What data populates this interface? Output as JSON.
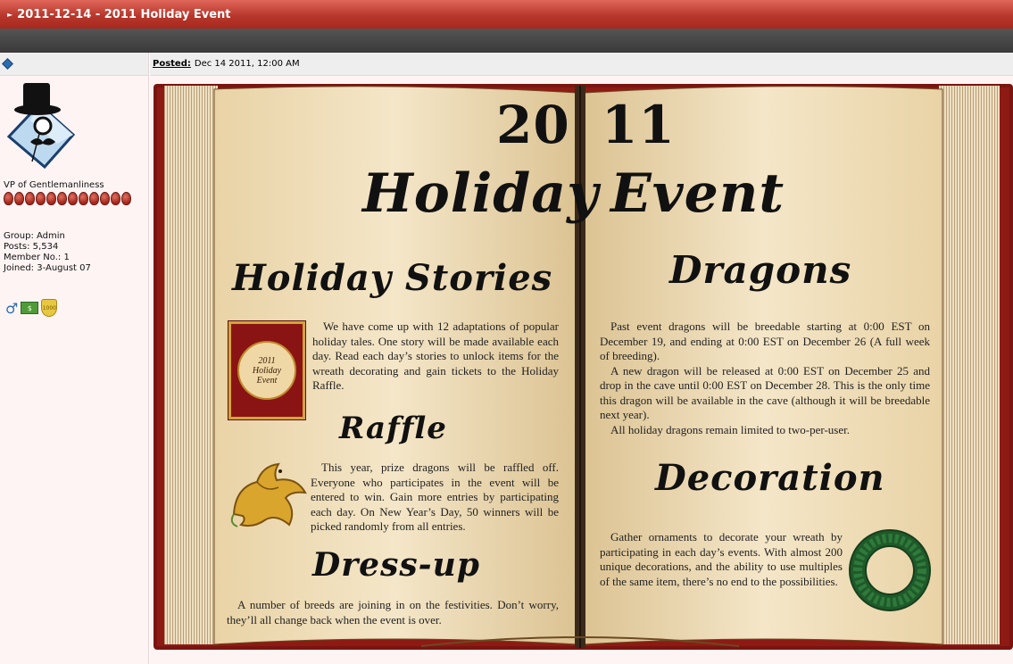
{
  "window": {
    "title": "2011-12-14 - 2011 Holiday Event"
  },
  "user": {
    "title": "VP of Gentlemanliness",
    "group": "Group: Admin",
    "posts": "Posts: 5,534",
    "member_no": "Member No.: 1",
    "joined": "Joined: 3-August 07",
    "pip_count": 12,
    "pip_color": "#b3291f"
  },
  "post": {
    "posted_label": "Posted:",
    "posted_date": "Dec 14 2011, 12:00 AM"
  },
  "book": {
    "year_left": "20",
    "year_right": "11",
    "title_left": "Holiday",
    "title_right": "Event",
    "holiday_stories": {
      "heading": "Holiday Stories",
      "text": "We have come up with 12 adaptations of popular holiday tales. One story will be made available each day. Read each day’s stories to unlock items for the wreath decorating and gain tickets to the Holiday Raffle.",
      "thumb_line1": "2011",
      "thumb_line2": "Holiday",
      "thumb_line3": "Event"
    },
    "raffle": {
      "heading": "Raffle",
      "text": "This year, prize dragons will be raffled off. Everyone who participates in the event will be entered to win. Gain more entries by participating each day. On New Year’s Day, 50 winners will be picked randomly from all entries."
    },
    "dress_up": {
      "heading": "Dress-up",
      "text": "A number of breeds are joining in on the festivities. Don’t worry, they’ll all change back when the event is over."
    },
    "dragons": {
      "heading": "Dragons",
      "p1": "Past event dragons will be breedable starting at 0:00 EST on December 19, and ending at 0:00 EST on December 26 (A full week of breeding).",
      "p2": "A new dragon will be released at 0:00 EST on December 25 and drop in the cave until 0:00 EST on December 28. This is the only time this dragon will be available in the cave (although it will be breedable next year).",
      "p3": "All holiday dragons remain limited to two-per-user."
    },
    "decoration": {
      "heading": "Decoration",
      "text": "Gather ornaments to decorate your wreath by participating in each day’s events. With almost 200 unique decorations, and the ability to use multiples of the same item, there’s no end to the possibilities."
    }
  },
  "colors": {
    "title_bar": "#b8372c",
    "book_cover": "#7a1410",
    "parchment": "#f0dfbc"
  }
}
